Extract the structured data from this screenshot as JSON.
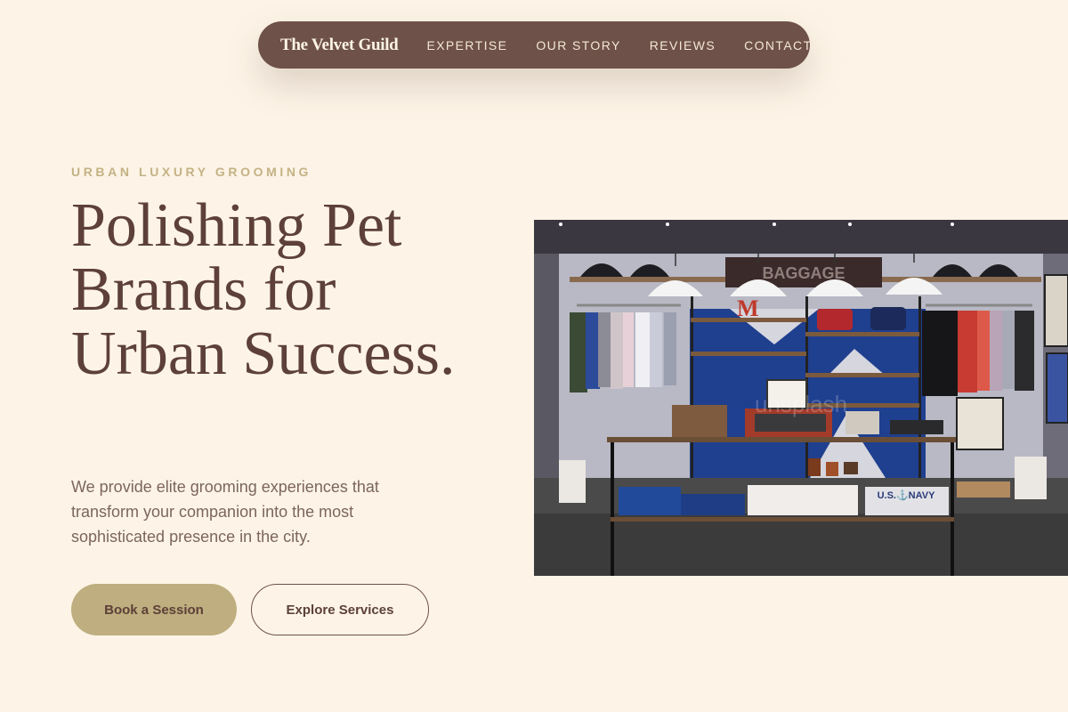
{
  "nav": {
    "brand": "The Velvet Guild",
    "links": [
      "EXPERTISE",
      "OUR STORY",
      "REVIEWS",
      "CONTACT"
    ]
  },
  "hero": {
    "eyebrow": "URBAN LUXURY GROOMING",
    "headline": "Polishing Pet Brands for Urban Success.",
    "description": "We provide elite grooming experiences that transform your companion into the most sophisticated presence in the city.",
    "primary_cta": "Book a Session",
    "secondary_cta": "Explore Services"
  },
  "image": {
    "shop_sign": "BAGGAGE",
    "shelf_letter": "M",
    "sweater_text": "U.S.⚓NAVY",
    "watermark": "unsplash"
  },
  "colors": {
    "background": "#fdf4e7",
    "nav_bg": "#6e5149",
    "accent_gold": "#bfae7f",
    "heading": "#5d4039",
    "body_text": "#7c655c"
  }
}
